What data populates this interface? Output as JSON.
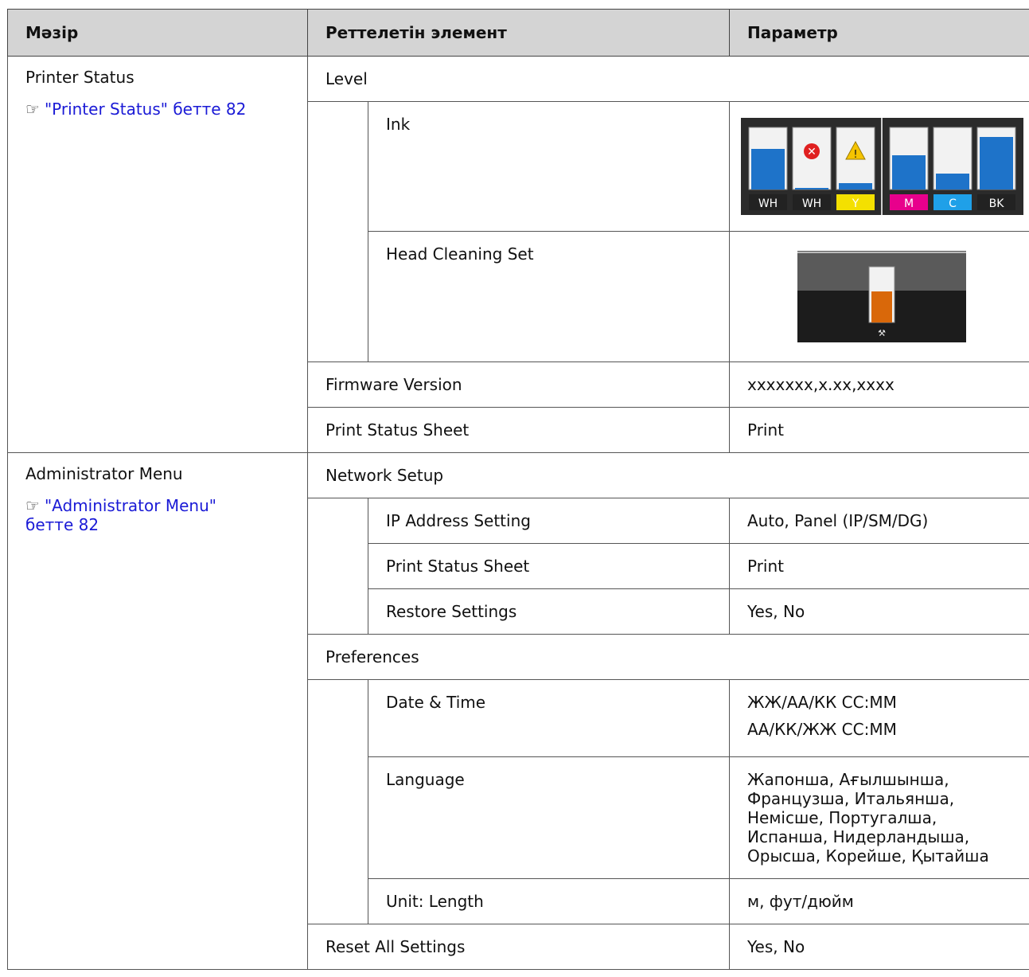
{
  "headers": {
    "menu": "Мәзір",
    "item": "Реттелетін элемент",
    "param": "Параметр"
  },
  "printer_status": {
    "menu_label": "Printer Status",
    "ref_text": "\"Printer Status\" бетте 82",
    "level": "Level",
    "ink": "Ink",
    "ink_labels": [
      "WH",
      "WH",
      "Y",
      "M",
      "C",
      "BK"
    ],
    "ink_label_colors": [
      "#ffffff",
      "#ffffff",
      "#f4e000",
      "#e8008c",
      "#1fa0e8",
      "#ffffff"
    ],
    "ink_levels": [
      0.65,
      0.0,
      0.1,
      0.55,
      0.25,
      0.85
    ],
    "ink_status_icons": [
      "none",
      "error-icon",
      "warning-icon",
      "none",
      "none",
      "none"
    ],
    "head_cleaning": "Head Cleaning Set",
    "head_cleaning_level": 0.55,
    "firmware": "Firmware Version",
    "firmware_value": "xxxxxxx,x.xx,xxxx",
    "print_status_sheet": "Print Status Sheet",
    "print_status_value": "Print"
  },
  "admin": {
    "menu_label": "Administrator Menu",
    "ref_line1": "\"Administrator Menu\"",
    "ref_line2": "бетте 82",
    "network_setup": "Network Setup",
    "ip_address": "IP Address Setting",
    "ip_address_value": "Auto, Panel (IP/SM/DG)",
    "print_status_sheet": "Print Status Sheet",
    "print_status_value": "Print",
    "restore": "Restore Settings",
    "restore_value": "Yes, No",
    "preferences": "Preferences",
    "date_time": "Date & Time",
    "date_time_value1": "ЖЖ/АА/КК СС:ММ",
    "date_time_value2": "АА/КК/ЖЖ СС:ММ",
    "language": "Language",
    "language_value": "Жапонша, Ағылшынша, Французша, Итальянша, Немісше, Португалша, Испанша, Нидерландыша, Орысша, Корейше, Қытайша",
    "unit_length": "Unit: Length",
    "unit_length_value": "м, фут/дюйм",
    "reset_all": "Reset All Settings",
    "reset_all_value": "Yes, No"
  }
}
